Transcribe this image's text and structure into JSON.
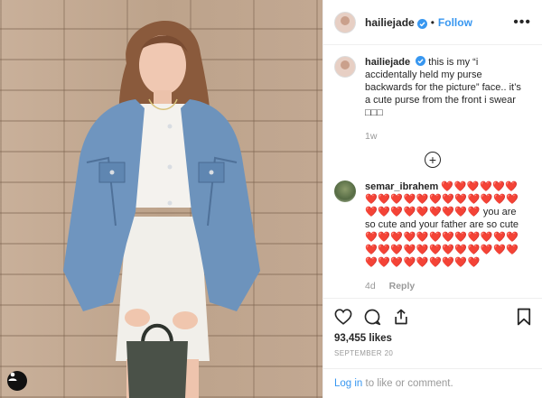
{
  "post": {
    "username": "hailiejade",
    "follow_label": "Follow",
    "separator": "•",
    "more_label": "•••",
    "caption": {
      "username": "hailiejade",
      "text": "this is my “i accidentally held my purse backwards for the picture” face.. it’s a cute purse from the front i swear □□□",
      "age": "1w"
    },
    "load_more_label": "+",
    "comments": [
      {
        "username": "semar_ibrahem",
        "hearts_before": "❤️❤️❤️❤️❤️❤️❤️❤️❤️❤️❤️❤️❤️❤️❤️❤️❤️❤️❤️❤️❤️❤️❤️❤️❤️❤️❤️",
        "text": "you are so cute and your father are so cute",
        "hearts_after": "❤️❤️❤️❤️❤️❤️❤️❤️❤️❤️❤️❤️❤️❤️❤️❤️❤️❤️❤️❤️❤️❤️❤️❤️❤️❤️❤️❤️❤️❤️❤️❤️❤️",
        "age": "4d",
        "reply_label": "Reply"
      }
    ],
    "likes": "93,455 likes",
    "date": "SEPTEMBER 20",
    "login_link": "Log in",
    "login_rest": " to like or comment."
  },
  "colors": {
    "link": "#3897f0",
    "verified": "#3897f0",
    "heart": "#ed2a47",
    "muted": "#999999"
  },
  "icons": [
    "heart-icon",
    "comment-icon",
    "share-icon",
    "bookmark-icon",
    "verified-icon",
    "user-tag-icon",
    "more-options-icon",
    "load-more-icon"
  ]
}
